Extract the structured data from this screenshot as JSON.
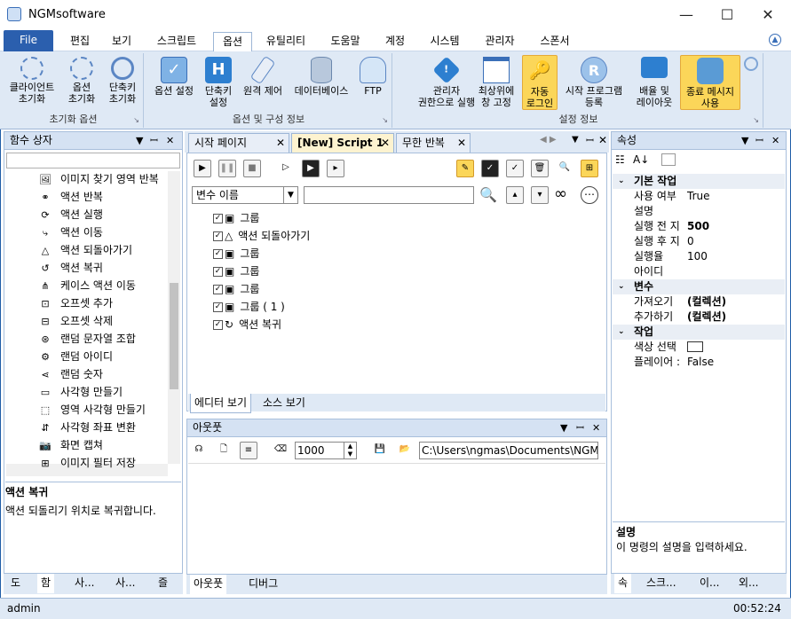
{
  "window": {
    "title": "NGMsoftware"
  },
  "menu": {
    "file": "File",
    "tabs": [
      "편집",
      "보기",
      "스크립트",
      "옵션",
      "유틸리티",
      "도움말",
      "계정",
      "시스템",
      "관리자",
      "스폰서"
    ],
    "active_index": 3
  },
  "ribbon": {
    "groups": [
      {
        "title": "초기화 옵션",
        "buttons": [
          [
            "클라이언트",
            "초기화"
          ],
          [
            "옵션",
            "초기화"
          ],
          [
            "단축키",
            "초기화"
          ]
        ]
      },
      {
        "title": "옵션 및 구성 정보",
        "buttons": [
          [
            "옵션 설정"
          ],
          [
            "단축키",
            "설정"
          ],
          [
            "원격 제어"
          ],
          [
            "데이터베이스"
          ],
          [
            "FTP"
          ]
        ]
      },
      {
        "title": "설정 정보",
        "buttons": [
          [
            "관리자",
            "권한으로 실행"
          ],
          [
            "최상위에",
            "창 고정"
          ],
          [
            "자동",
            "로그인"
          ],
          [
            "시작 프로그램",
            "등록"
          ],
          [
            "배율 및",
            "레이아웃"
          ],
          [
            "종료 메시지",
            "사용"
          ]
        ]
      }
    ]
  },
  "left_panel": {
    "title": "함수 상자",
    "items": [
      {
        "label": "이미지 찾기 영역 반복",
        "icon": "image-search-icon"
      },
      {
        "label": "액션 반복",
        "icon": "loop-icon"
      },
      {
        "label": "액션 실행",
        "icon": "run-icon"
      },
      {
        "label": "액션 이동",
        "icon": "move-icon"
      },
      {
        "label": "액션 되돌아가기",
        "icon": "return-icon"
      },
      {
        "label": "액션 복귀",
        "icon": "restore-icon"
      },
      {
        "label": "케이스 액션 이동",
        "icon": "case-icon"
      },
      {
        "label": "오프셋 추가",
        "icon": "offset-add-icon"
      },
      {
        "label": "오프셋 삭제",
        "icon": "offset-delete-icon"
      },
      {
        "label": "랜덤 문자열 조합",
        "icon": "random-string-icon"
      },
      {
        "label": "랜덤 아이디",
        "icon": "random-id-icon"
      },
      {
        "label": "랜덤 숫자",
        "icon": "random-number-icon"
      },
      {
        "label": "사각형 만들기",
        "icon": "rectangle-icon"
      },
      {
        "label": "영역 사각형 만들기",
        "icon": "area-rectangle-icon"
      },
      {
        "label": "사각형 좌표 변환",
        "icon": "rect-convert-icon"
      },
      {
        "label": "화면 캡쳐",
        "icon": "camera-icon"
      },
      {
        "label": "이미지 필터 저장",
        "icon": "filter-icon"
      }
    ],
    "desc_title": "액션 복귀",
    "desc_text": "액션 되돌리기 위치로 복귀합니다.",
    "bottom_tabs": [
      "도",
      "함",
      "사...",
      "사...",
      "즐"
    ]
  },
  "doc_tabs": [
    "시작 페이지",
    "[New] Script 1",
    "무한 반복"
  ],
  "editor": {
    "var_select": "변수 이름",
    "tree": [
      {
        "label": "그룹",
        "icon": "group-icon"
      },
      {
        "label": "액션 되돌아가기",
        "icon": "return-icon"
      },
      {
        "label": "그룹",
        "icon": "group-icon"
      },
      {
        "label": "그룹",
        "icon": "group-icon"
      },
      {
        "label": "그룹",
        "icon": "group-icon"
      },
      {
        "label": "그룹 ( 1 )",
        "icon": "group-icon"
      },
      {
        "label": "액션 복귀",
        "icon": "restore-icon"
      }
    ],
    "view_tabs": [
      "에디터 보기",
      "소스 보기"
    ]
  },
  "output": {
    "title": "아웃풋",
    "count": "1000",
    "path": "C:\\Users\\ngmas\\Documents\\NGM6\\",
    "bottom_tabs": [
      "아웃풋",
      "디버그"
    ]
  },
  "properties": {
    "title": "속성",
    "categories": [
      {
        "name": "기본 작업",
        "rows": [
          [
            "사용 여부",
            "True"
          ],
          [
            "설명",
            ""
          ],
          [
            "실행 전 지",
            "500"
          ],
          [
            "실행 후 지",
            "0"
          ],
          [
            "실행율",
            "100"
          ],
          [
            "아이디",
            ""
          ]
        ]
      },
      {
        "name": "변수",
        "rows": [
          [
            "가져오기",
            "(컬렉션)"
          ],
          [
            "추가하기",
            "(컬렉션)"
          ]
        ]
      },
      {
        "name": "작업",
        "rows": [
          [
            "색상 선택",
            ""
          ],
          [
            "플레이어 :",
            "False"
          ]
        ]
      }
    ],
    "desc_title": "설명",
    "desc_text": "이 명령의 설명을 입력하세요.",
    "bottom_tabs": [
      "속",
      "스크...",
      "이...",
      "외..."
    ]
  },
  "status": {
    "user": "admin",
    "time": "00:52:24"
  },
  "colors": {
    "accent": "#2b5fae",
    "highlight": "#fbd659",
    "pane_header": "#d5e2f3"
  }
}
